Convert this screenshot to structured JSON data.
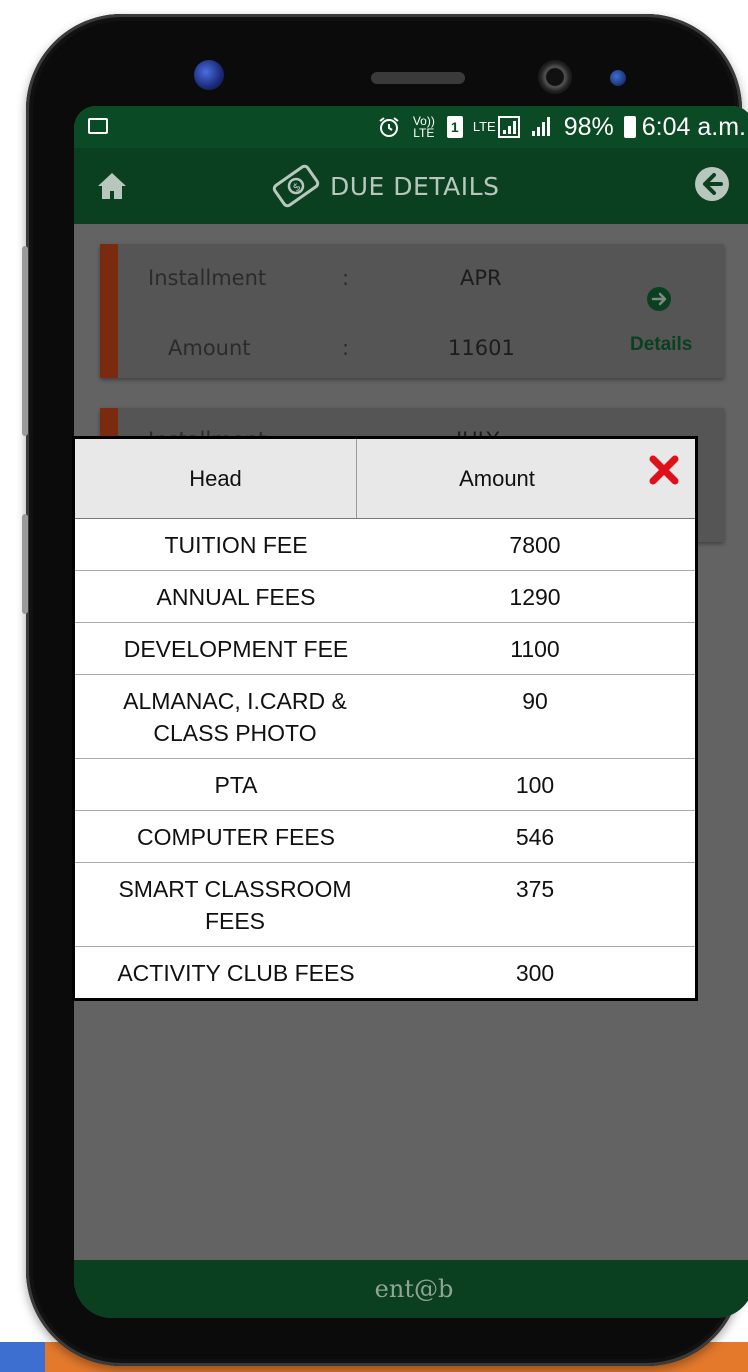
{
  "status_bar": {
    "volte": "Vo)) LTE",
    "sim": "1",
    "lte": "LTE",
    "battery": "98%",
    "time": "6:04 a.m."
  },
  "header": {
    "title": "DUE DETAILS"
  },
  "installments": [
    {
      "installment_label": "Installment",
      "installment_value": "APR",
      "amount_label": "Amount",
      "amount_value": "11601",
      "details_label": "Details",
      "separator": ":"
    },
    {
      "installment_label": "Installment",
      "installment_value": "JULY",
      "separator": ":"
    }
  ],
  "modal": {
    "columns": [
      "Head",
      "Amount"
    ],
    "rows": [
      {
        "head": "TUITION FEE",
        "amount": "7800"
      },
      {
        "head": "ANNUAL FEES",
        "amount": "1290"
      },
      {
        "head": "DEVELOPMENT FEE",
        "amount": "1100"
      },
      {
        "head": "ALMANAC, I.CARD & CLASS PHOTO",
        "amount": "90"
      },
      {
        "head": "PTA",
        "amount": "100"
      },
      {
        "head": "COMPUTER FEES",
        "amount": "546"
      },
      {
        "head": "SMART CLASSROOM FEES",
        "amount": "375"
      },
      {
        "head": "ACTIVITY CLUB FEES",
        "amount": "300"
      }
    ]
  },
  "footer": {
    "logo": "ent@b"
  },
  "colors": {
    "header_bg": "#0a3f1f",
    "status_bg": "#0a4a25",
    "card_stripe": "#7a2a0e",
    "close_red": "#e0101a"
  }
}
